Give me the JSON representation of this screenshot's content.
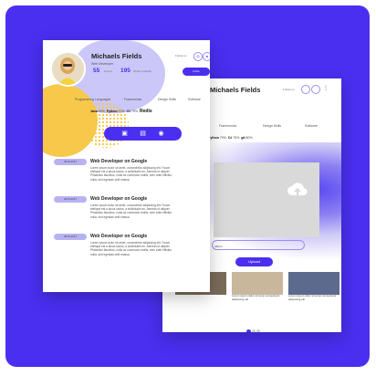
{
  "back": {
    "name": "Michaels Fields",
    "follow_label": "Follow us",
    "tabs": [
      "Frameworks",
      "Design Skills",
      "Software"
    ],
    "skills": [
      {
        "name": "Python",
        "value": "70%"
      },
      {
        "name": "C#",
        "value": "75%"
      },
      {
        "name": "git",
        "value": "80%"
      }
    ],
    "upload_label": "Album",
    "upload_button": "Upload",
    "thumbs": [
      {
        "caption": "Lorem ipsum dolor sit amet consectetur adipiscing elit",
        "color": "#c9b79c"
      },
      {
        "caption": "Lorem ipsum dolor sit amet consectetur adipiscing elit",
        "color": "#5c6a8e"
      }
    ]
  },
  "front": {
    "name": "Michaels Fields",
    "role": "Web Developer",
    "stats": [
      {
        "value": "55",
        "label": "Projects"
      },
      {
        "value": "195",
        "label": "Weekly Availability"
      }
    ],
    "follow_label": "Follow us",
    "invite_label": "Invite",
    "tabs": [
      "Programming Languages",
      "Frameworks",
      "Design Skills",
      "Software"
    ],
    "skills": [
      {
        "name": "Java",
        "value": "90%"
      },
      {
        "name": "Python",
        "value": "70%"
      },
      {
        "name": "C#",
        "value": "75%"
      },
      {
        "name": "Redis",
        "value": ""
      }
    ],
    "entries": [
      {
        "date": "2015-2017",
        "title": "Web Developer on Google",
        "body": "Lorem ipsum dolor sit amet, consectetur adipiscing elit. Fusce tristique est a lacus luctus, a sollicitudin eu. Aenean ut aliquet. Phasellus faucibus, nulla ac commodo mollis, sem ante efficitur nulla, sed egestas velit massa."
      },
      {
        "date": "2015-2017",
        "title": "Web Developer on Google",
        "body": "Lorem ipsum dolor sit amet, consectetur adipiscing elit. Fusce tristique est a lacus luctus, a sollicitudin eu. Aenean ut aliquet. Phasellus faucibus, nulla ac commodo mollis, sem ante efficitur nulla, sed egestas velit massa."
      },
      {
        "date": "2015-2017",
        "title": "Web Developer on Google",
        "body": "Lorem ipsum dolor sit amet, consectetur adipiscing elit. Fusce tristique est a lacus luctus, a sollicitudin eu. Aenean ut aliquet. Phasellus faucibus, nulla ac commodo mollis, sem ante efficitur nulla, sed egestas velit massa."
      }
    ],
    "toolbar_icons": [
      "image-icon",
      "briefcase-icon",
      "eye-icon"
    ]
  },
  "colors": {
    "accent": "#4a2ff0",
    "date_pill": "#b7b3f2",
    "yellow": "#f7c84a"
  }
}
